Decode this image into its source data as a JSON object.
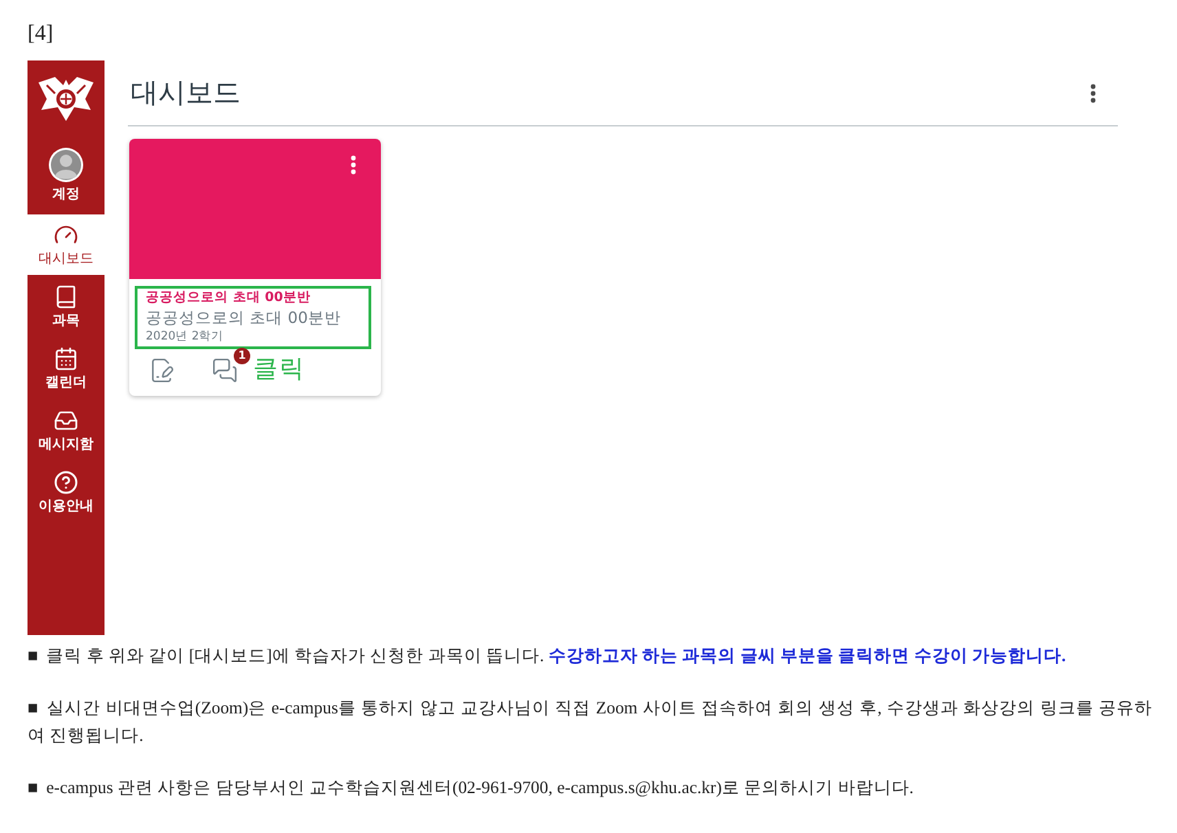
{
  "page_label": "[4]",
  "sidebar": {
    "items": [
      {
        "label": "계정",
        "kind": "account",
        "selected": false
      },
      {
        "label": "대시보드",
        "kind": "dashboard",
        "selected": true
      },
      {
        "label": "과목",
        "kind": "courses",
        "selected": false
      },
      {
        "label": "캘린더",
        "kind": "calendar",
        "selected": false
      },
      {
        "label": "메시지함",
        "kind": "inbox",
        "selected": false
      },
      {
        "label": "이용안내",
        "kind": "help",
        "selected": false
      }
    ]
  },
  "header": {
    "title": "대시보드"
  },
  "course_cards": [
    {
      "title": "공공성으로의 초대 00분반",
      "subtitle": "공공성으로의 초대 00분반",
      "term": "2020년 2학기",
      "color": "#e5195f",
      "highlighted": true,
      "unread_count": "1",
      "callout": "클릭"
    }
  ],
  "notes": [
    {
      "marker": "■",
      "text": "클릭 후 위와 같이 [대시보드]에 학습자가 신청한 과목이 뜹니다. **수강하고자 하는 과목의 글씨 부분을 클릭하면 수강이 가능합니다.**"
    },
    {
      "marker": "■",
      "text": "실시간 비대면수업(Zoom)은 e-campus를 통하지 않고 교강사님이 직접 Zoom 사이트 접속하여 회의 생성 후, 수강생과 화상강의 링크를 공유하여 진행됩니다."
    },
    {
      "marker": "■",
      "text": "e-campus 관련 사항은 담당부서인 교수학습지원센터(02-961-9700, e-campus.s@khu.ac.kr)로 문의하시기 바랍니다."
    }
  ]
}
